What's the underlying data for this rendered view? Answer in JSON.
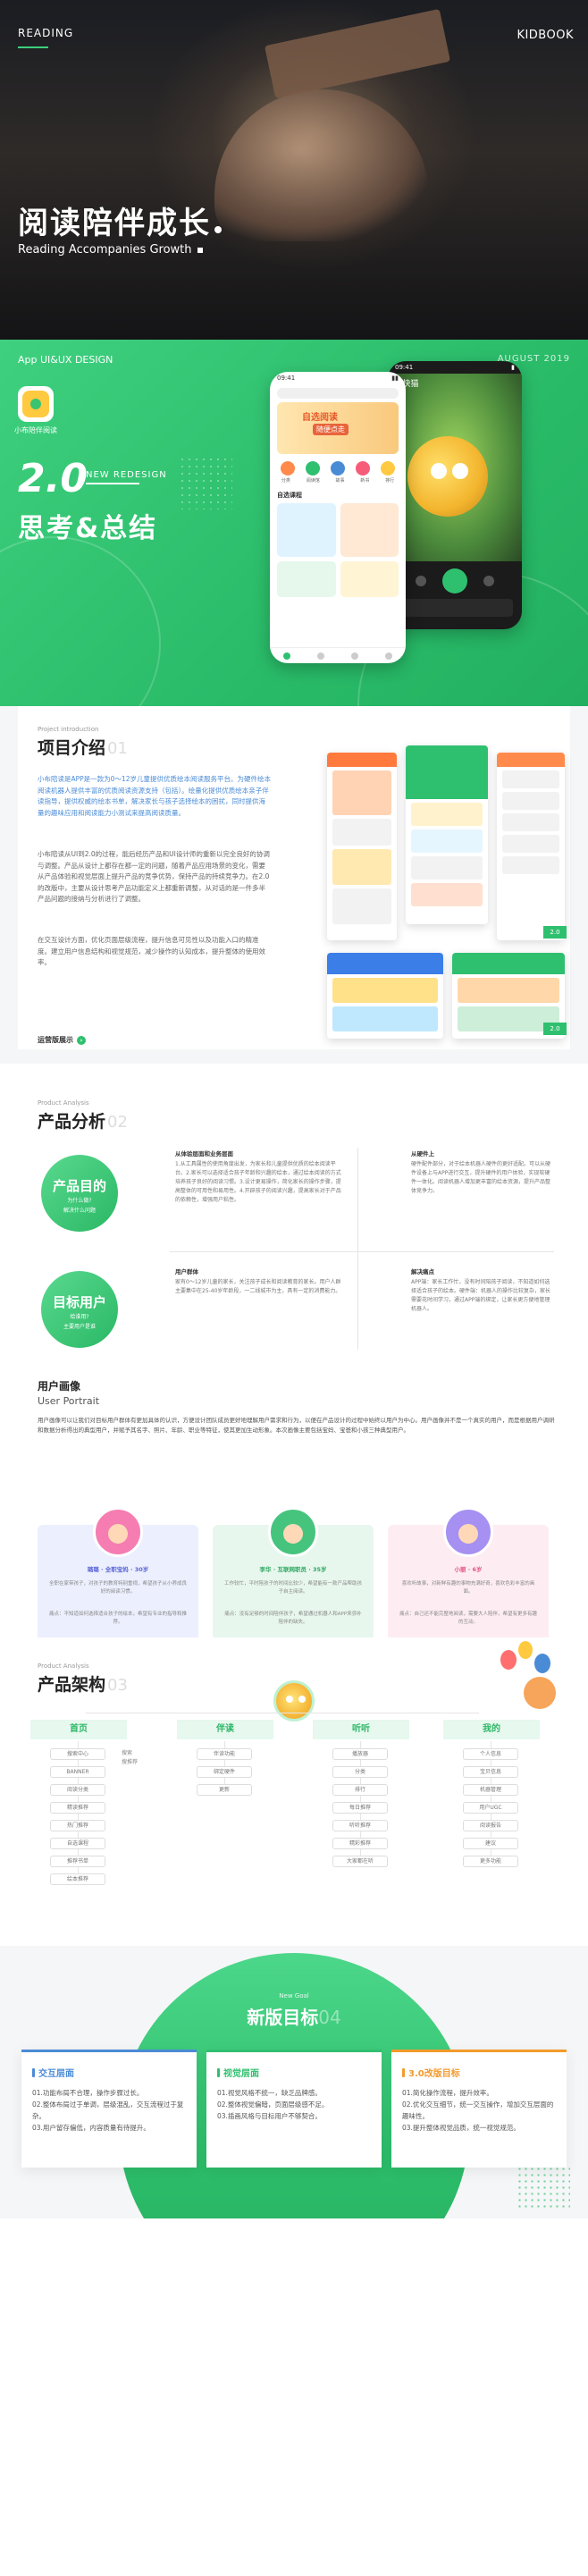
{
  "hero": {
    "top_left": "READING",
    "top_right": "KIDBOOK",
    "title": "阅读陪伴成长",
    "subtitle": "Reading Accompanies Growth"
  },
  "banner": {
    "app_label": "App UI&UX DESIGN",
    "date": "AUGUST 2019",
    "app_name": "小布陪伴阅读",
    "version": "2.0",
    "redesign": "NEW REDESIGN",
    "thinking": "思考&总结",
    "phone_a": {
      "time": "09:41",
      "banner_title": "自选阅读",
      "banner_tag": "随便点走",
      "categories": [
        "分类",
        "阅读馆",
        "故事",
        "新书",
        "排行"
      ],
      "section": "自选课程"
    },
    "phone_b": {
      "back": "‹ 快猫"
    }
  },
  "intro": {
    "small": "Project introduction",
    "title": "项目介绍",
    "num": "01",
    "para1": "小布陪读是APP是一款为0～12岁儿童提供优质绘本阅读服务平台。为硬件绘本阅读机器人提供丰富的优质阅读资源支持（包括）。绘量化提供优质绘本亲子伴读指导，提供权威的绘本书单，解决家长与孩子选择绘本的困扰，同时提供海量的趣味应用和阅读能力小测试来提高阅读质量。",
    "para2": "小布陪读从UI到2.0的过程，能后经历产品和UI设计师的重新以完全良好的协调与调整。产品从设计上都存在都一定的问题，随着产品应用场景的变化，需要从产品体验和视觉层面上提升产品的竞争优势，保持产品的持续竞争力。在2.0的改版中，主要从设计思考产品功能定义上都重新调整，从对话的是一件多半产品问题的接纳与分析进行了调整。",
    "para3": "在交互设计方面，优化页面层级流程，提升信息可见性以及功能入口的精准度。建立用户信息结构和视觉规范，减少操作的认知成本，提升整体的使用效率。",
    "more": "运营版展示"
  },
  "analysis": {
    "small": "Product Analysis",
    "title": "产品分析",
    "num": "02",
    "goal": {
      "big": "产品目的",
      "small1": "为什么做?",
      "small2": "解决什么问题"
    },
    "target": {
      "big": "目标用户",
      "small1": "给谁用?",
      "small2": "主要用户是谁"
    },
    "col1_head": "从体验层面和业务层面",
    "col1_text": "1.从工具属性的使用角度出发，为家长和儿童提供优质的绘本阅读平台。2.家长可以选择适合孩子年龄和兴趣的绘本，通过绘本阅读的方式培养孩子良好的阅读习惯。3.设计更易操作，简化家长的操作步骤，提高整体的可用性和易用性。4.开辟孩子的阅读兴趣，提高家长对于产品的依赖性，增强用户粘性。",
    "col2_head": "从硬件上",
    "col2_text": "硬件配件部分，对于绘本机器人硬件的更好适配。可以从硬件设备上与APP进行交互，提升硬件的用户体验，实现软硬件一体化。阅读机器人增加更丰富的绘本资源，提升产品整体竞争力。",
    "col3_head": "用户群体",
    "col3_text": "家有0～12岁儿童的家长，关注孩子成长和阅读教育的家长。用户人群主要集中在25-40岁年龄段，一二线城市为主，具有一定的消费能力。",
    "col4_head": "解决痛点",
    "col4_text": "APP端：家长工作忙，没有时间陪孩子阅读，不知道如何选择适合孩子的绘本。硬件端：机器人的操作比较复杂，家长需要花时间学习，通过APP端的绑定，让家长更方便地管理机器人。",
    "persona_title": "用户画像",
    "persona_sub": "User Portrait",
    "persona_text": "用户画像可以让我们对目标用户群体有更加具体的认识，方便设计团队成员更好地理解用户需求和行为，以便在产品设计的过程中始终以用户为中心。用户画像并不是一个真实的用户，而是根据用户调研和数据分析得出的典型用户，并赋予其名字、照片、年龄、职业等特征，使其更加生动形象。本次画像主要包括宝妈、宝爸和小孩三种典型用户。"
  },
  "personas": [
    {
      "name": "璐璐 · 全职宝妈 · 30岁",
      "p1": "全职在家带孩子，对孩子的教育特别重视，希望孩子从小养成良好的阅读习惯。",
      "p2": "痛点：不知道如何选择适合孩子的绘本，希望有专业的指导和推荐。"
    },
    {
      "name": "李华 · 互联网职员 · 35岁",
      "p1": "工作较忙，平时陪孩子的时间比较少，希望能有一款产品帮助孩子自主阅读。",
      "p2": "痛点：没有足够的时间陪伴孩子，希望通过机器人和APP来弥补陪伴的缺失。"
    },
    {
      "name": "小丽 · 6岁",
      "p1": "喜欢听故事，对新鲜有趣的事物充满好奇，喜欢色彩丰富的画面。",
      "p2": "痛点：自己还不能完整地阅读，需要大人陪伴，希望有更多有趣的互动。"
    }
  ],
  "arch": {
    "small": "Product Analysis",
    "title": "产品架构",
    "num": "03",
    "columns": [
      {
        "head": "首页",
        "nodes": [
          "搜索中心",
          "BANNER",
          "阅读分类",
          "精读推荐",
          "热门推荐",
          "自选课程",
          "推荐书单",
          "绘本推荐"
        ],
        "subs": [
          "搜索",
          "搜推荐"
        ]
      },
      {
        "head": "伴读",
        "nodes": [
          "伴读功能",
          "绑定硬件",
          "更新"
        ],
        "subs": []
      },
      {
        "head": "听听",
        "nodes": [
          "播放器",
          "分类",
          "排行",
          "每日推荐",
          "听听推荐",
          "精彩推荐",
          "大家都在听"
        ],
        "subs": []
      },
      {
        "head": "我的",
        "nodes": [
          "个人信息",
          "宝贝信息",
          "机器管理",
          "用户UGC",
          "阅读报告",
          "建议",
          "更多功能"
        ],
        "subs": []
      }
    ]
  },
  "goals": {
    "small": "New Goal",
    "title": "新版目标",
    "num": "04",
    "cards": [
      {
        "head": "交互层面",
        "lines": [
          "01.功能布局不合理，操作步骤过长。",
          "02.整体布局过于单调，层级混乱，交互流程过于复杂。",
          "03.用户留存偏低，内容质量有待提升。"
        ]
      },
      {
        "head": "视觉层面",
        "lines": [
          "01.视觉风格不统一，缺乏品牌感。",
          "02.整体视觉偏暗，页面层级感不足。",
          "03.插画风格与目标用户不够契合。"
        ]
      },
      {
        "head": "3.0改版目标",
        "lines": [
          "01.简化操作流程，提升效率。",
          "02.优化交互细节，统一交互操作，增加交互层面的趣味性。",
          "03.提升整体视觉品质，统一视觉规范。"
        ]
      }
    ]
  },
  "colors": {
    "brand_green": "#2fc06f",
    "accent_orange": "#f39a2c",
    "accent_blue": "#4a8bd6"
  }
}
